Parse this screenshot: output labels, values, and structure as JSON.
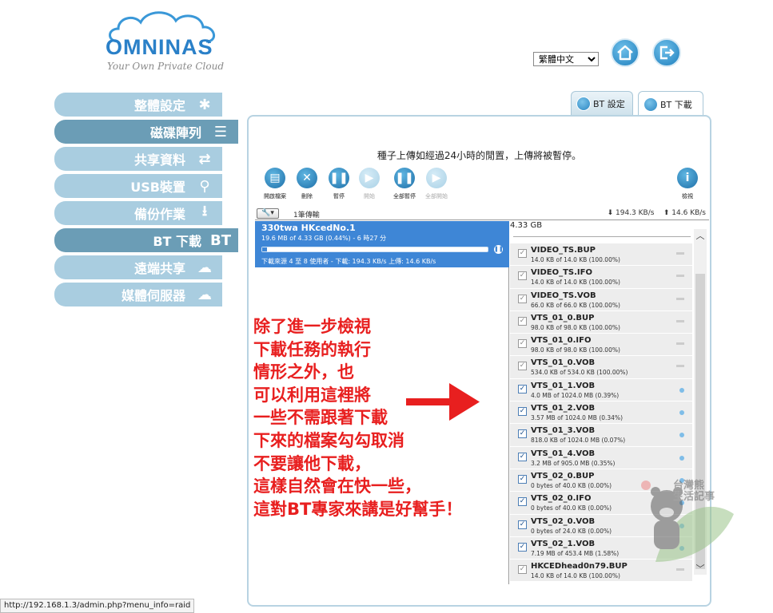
{
  "logo": {
    "name": "OMNINAS",
    "tagline": "Your Own Private Cloud"
  },
  "language": {
    "selected": "繁體中文"
  },
  "menu": [
    {
      "label": "整體設定",
      "icon": "tools-icon",
      "glyph": "✱",
      "active": false
    },
    {
      "label": "磁碟陣列",
      "icon": "disk-array-icon",
      "glyph": "☰",
      "active": true
    },
    {
      "label": "共享資料",
      "icon": "share-arrows-icon",
      "glyph": "⇄",
      "active": false
    },
    {
      "label": "USB裝置",
      "icon": "usb-icon",
      "glyph": "⚲",
      "active": false
    },
    {
      "label": "備份作業",
      "icon": "backup-icon",
      "glyph": "⭳",
      "active": false
    },
    {
      "label": "BT 下載",
      "icon": "bt-download-icon",
      "glyph": "BT",
      "active": true
    },
    {
      "label": "遠端共享",
      "icon": "remote-share-icon",
      "glyph": "☁",
      "active": false
    },
    {
      "label": "媒體伺服器",
      "icon": "media-server-icon",
      "glyph": "☁",
      "active": false
    }
  ],
  "tabs": [
    {
      "label": "BT 設定"
    },
    {
      "label": "BT 下載"
    }
  ],
  "notice": "種子上傳如經過24小時的閒置，上傳將被暫停。",
  "toolbar": [
    {
      "label": "開啟檔案",
      "icon": "open-file-icon",
      "glyph": "▤",
      "disabled": false
    },
    {
      "label": "刪除",
      "icon": "delete-icon",
      "glyph": "✕",
      "disabled": false
    },
    {
      "label": "暫停",
      "icon": "pause-icon",
      "glyph": "❚❚",
      "disabled": false
    },
    {
      "label": "開始",
      "icon": "play-icon",
      "glyph": "▶",
      "disabled": true
    },
    {
      "label": "全部暫停",
      "icon": "pause-all-icon",
      "glyph": "❚❚",
      "disabled": false
    },
    {
      "label": "全部開始",
      "icon": "play-all-icon",
      "glyph": "▶",
      "disabled": true
    },
    {
      "label": "檢視",
      "icon": "info-icon",
      "glyph": "i",
      "disabled": false
    }
  ],
  "status": {
    "count": "1筆傳輸",
    "download_speed": "⬇ 194.3 KB/s",
    "upload_speed": "⬆ 14.6 KB/s"
  },
  "task": {
    "name": "330twa HKcedNo.1",
    "meta": "19.6 MB of 4.33 GB (0.44%) - 6 時27 分",
    "progress": 0.44,
    "peers": "下載來源 4 至 8 使用者 - 下載: 194.3 KB/s 上傳: 14.6 KB/s"
  },
  "files": {
    "total_size": "4.33 GB",
    "rows": [
      {
        "name": "VIDEO_TS.BUP",
        "size": "14.0 KB of 14.0 KB (100.00%)",
        "checked": false,
        "done": true
      },
      {
        "name": "VIDEO_TS.IFO",
        "size": "14.0 KB of 14.0 KB (100.00%)",
        "checked": false,
        "done": true
      },
      {
        "name": "VIDEO_TS.VOB",
        "size": "66.0 KB of 66.0 KB (100.00%)",
        "checked": false,
        "done": true
      },
      {
        "name": "VTS_01_0.BUP",
        "size": "98.0 KB of 98.0 KB (100.00%)",
        "checked": false,
        "done": true
      },
      {
        "name": "VTS_01_0.IFO",
        "size": "98.0 KB of 98.0 KB (100.00%)",
        "checked": false,
        "done": true
      },
      {
        "name": "VTS_01_0.VOB",
        "size": "534.0 KB of 534.0 KB (100.00%)",
        "checked": false,
        "done": true
      },
      {
        "name": "VTS_01_1.VOB",
        "size": "4.0 MB of 1024.0 MB (0.39%)",
        "checked": true,
        "done": false
      },
      {
        "name": "VTS_01_2.VOB",
        "size": "3.57 MB of 1024.0 MB (0.34%)",
        "checked": true,
        "done": false
      },
      {
        "name": "VTS_01_3.VOB",
        "size": "818.0 KB of 1024.0 MB (0.07%)",
        "checked": true,
        "done": false
      },
      {
        "name": "VTS_01_4.VOB",
        "size": "3.2 MB of 905.0 MB (0.35%)",
        "checked": true,
        "done": false
      },
      {
        "name": "VTS_02_0.BUP",
        "size": "0 bytes of 40.0 KB (0.00%)",
        "checked": true,
        "done": false
      },
      {
        "name": "VTS_02_0.IFO",
        "size": "0 bytes of 40.0 KB (0.00%)",
        "checked": true,
        "done": false
      },
      {
        "name": "VTS_02_0.VOB",
        "size": "0 bytes of 24.0 KB (0.00%)",
        "checked": true,
        "done": false
      },
      {
        "name": "VTS_02_1.VOB",
        "size": "7.19 MB of 453.4 MB (1.58%)",
        "checked": true,
        "done": false
      },
      {
        "name": "HKCEDhead0n79.BUP",
        "size": "14.0 KB of 14.0 KB (100.00%)",
        "checked": false,
        "done": true
      }
    ]
  },
  "annotation": [
    "除了進一步檢視",
    "下載任務的執行",
    "情形之外，也",
    "可以利用這裡將",
    "一些不需跟著下載",
    "下來的檔案勾勾取消",
    "不要讓他下載，",
    "這樣自然會在快一些，",
    "這對BT專家來講是好幫手！"
  ],
  "watermark": {
    "line1": "台灣熊",
    "line2": "生活記事"
  },
  "status_url": "http://192.168.1.3/admin.php?menu_info=raid",
  "colors": {
    "accent": "#2a80c8",
    "menu_light": "#a9cde0",
    "menu_dark": "#6b9db6",
    "task_bg": "#3e86d6",
    "annotation": "#e81f1f"
  }
}
